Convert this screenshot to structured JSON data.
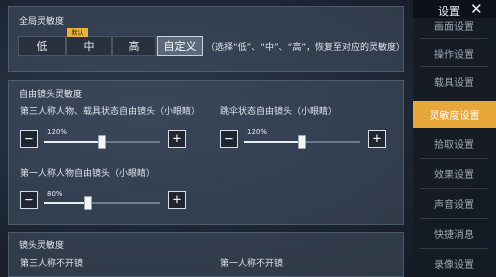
{
  "global_sensitivity": {
    "title": "全局灵敏度",
    "levels": [
      {
        "label": "低",
        "selected": false
      },
      {
        "label": "中",
        "selected": false
      },
      {
        "label": "高",
        "selected": false
      },
      {
        "label": "自定义",
        "selected": true
      }
    ],
    "default_tag": "默认",
    "hint": "（选择“低”、“中”、“高”，恢复至对应的灵敏度）"
  },
  "free_camera": {
    "title": "自由镜头灵敏度",
    "sliders": [
      {
        "label": "第三人称人物、载具状态自由镜头（小眼睛）",
        "percent": "120%",
        "value": 0.5
      },
      {
        "label": "跳伞状态自由镜头（小眼睛）",
        "percent": "120%",
        "value": 0.5
      },
      {
        "label": "第一人称人物自由镜头（小眼睛）",
        "percent": "80%",
        "value": 0.38
      }
    ],
    "minus": "−",
    "plus": "+"
  },
  "camera_sensitivity": {
    "title": "镜头灵敏度",
    "columns": [
      "第三人称不开镜",
      "第一人称不开镜"
    ]
  },
  "sidebar": {
    "title": "设置",
    "close": "✕",
    "items": [
      {
        "label": "画面设置",
        "active": false
      },
      {
        "label": "操作设置",
        "active": false
      },
      {
        "label": "载具设置",
        "active": false
      },
      {
        "label": "灵敏度设置",
        "active": true
      },
      {
        "label": "拾取设置",
        "active": false
      },
      {
        "label": "效果设置",
        "active": false
      },
      {
        "label": "声音设置",
        "active": false
      },
      {
        "label": "快捷消息",
        "active": false
      },
      {
        "label": "录像设置",
        "active": false
      }
    ]
  },
  "colors": {
    "accent": "#e8a73a",
    "default_tag": "#e7b33c"
  }
}
